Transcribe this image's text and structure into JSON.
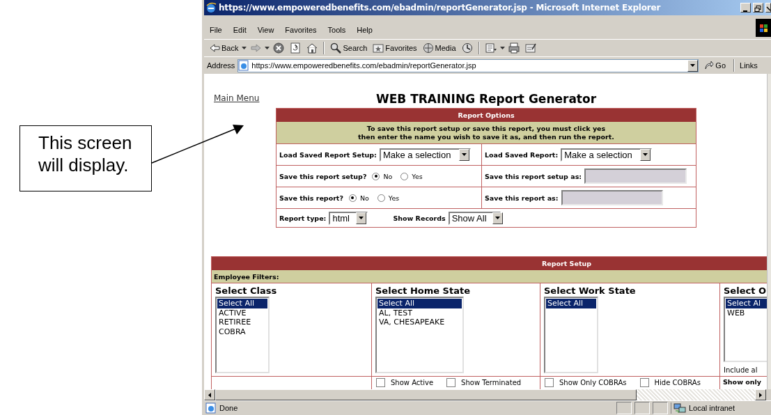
{
  "annotation": {
    "text": "This screen will display."
  },
  "window": {
    "title": "https://www.empoweredbenefits.com/ebadmin/reportGenerator.jsp - Microsoft Internet Explorer"
  },
  "menu": [
    "File",
    "Edit",
    "View",
    "Favorites",
    "Tools",
    "Help"
  ],
  "toolbar": [
    {
      "kind": "back",
      "label": "Back"
    },
    {
      "kind": "forward"
    },
    {
      "kind": "stop"
    },
    {
      "kind": "refresh"
    },
    {
      "kind": "home"
    },
    {
      "kind": "search",
      "label": "Search"
    },
    {
      "kind": "favorites",
      "label": "Favorites"
    },
    {
      "kind": "media",
      "label": "Media"
    },
    {
      "kind": "history"
    },
    {
      "kind": "mail"
    },
    {
      "kind": "print"
    },
    {
      "kind": "edit"
    }
  ],
  "address_bar": {
    "label": "Address",
    "value": "https://www.empoweredbenefits.com/ebadmin/reportGenerator.jsp",
    "go": "Go",
    "links": "Links"
  },
  "page": {
    "main_menu": "Main Menu",
    "title": "WEB TRAINING Report Generator",
    "report_options": {
      "header": "Report Options",
      "notice": [
        "To save this report setup or save this report, you must click yes",
        "then enter the name you wish to save it as, and then run the report."
      ],
      "load_setup": {
        "label": "Load Saved Report Setup:",
        "value": "Make a selection"
      },
      "load_report": {
        "label": "Load Saved Report:",
        "value": "Make a selection"
      },
      "save_setup": {
        "label": "Save this report setup?",
        "options": [
          {
            "label": "No",
            "selected": true
          },
          {
            "label": "Yes",
            "selected": false
          }
        ]
      },
      "save_setup_as": {
        "label": "Save this report setup as:"
      },
      "save_report": {
        "label": "Save this report?",
        "options": [
          {
            "label": "No",
            "selected": true
          },
          {
            "label": "Yes",
            "selected": false
          }
        ]
      },
      "save_report_as": {
        "label": "Save this report as:"
      },
      "report_type": {
        "label": "Report type:",
        "value": "html"
      },
      "show_records": {
        "label": "Show Records",
        "value": "Show All"
      }
    },
    "report_setup": {
      "header": "Report Setup",
      "section": "Employee Filters:",
      "filters": [
        {
          "title": "Select Class",
          "options": [
            {
              "label": "Select All",
              "selected": true
            },
            {
              "label": "ACTIVE",
              "selected": false
            },
            {
              "label": "RETIREE",
              "selected": false
            },
            {
              "label": "COBRA",
              "selected": false
            }
          ]
        },
        {
          "title": "Select Home State",
          "options": [
            {
              "label": "Select All",
              "selected": true
            },
            {
              "label": "AL, TEST",
              "selected": false
            },
            {
              "label": "VA, CHESAPEAKE",
              "selected": false
            }
          ],
          "checkboxes": [
            {
              "label": "Show Active",
              "checked": false
            },
            {
              "label": "Show Terminated",
              "checked": false
            }
          ]
        },
        {
          "title": "Select Work State",
          "options": [
            {
              "label": "Select All",
              "selected": true
            }
          ],
          "checkboxes": [
            {
              "label": "Show Only COBRAs",
              "checked": false
            },
            {
              "label": "Hide COBRAs",
              "checked": false
            }
          ]
        },
        {
          "title": "Select O",
          "options": [
            {
              "label": "Select Al",
              "selected": true
            },
            {
              "label": "WEB",
              "selected": false
            }
          ],
          "note": "Include al",
          "footer": "Show only"
        }
      ]
    }
  },
  "status_bar": {
    "text": "Done",
    "zone": "Local intranet"
  }
}
